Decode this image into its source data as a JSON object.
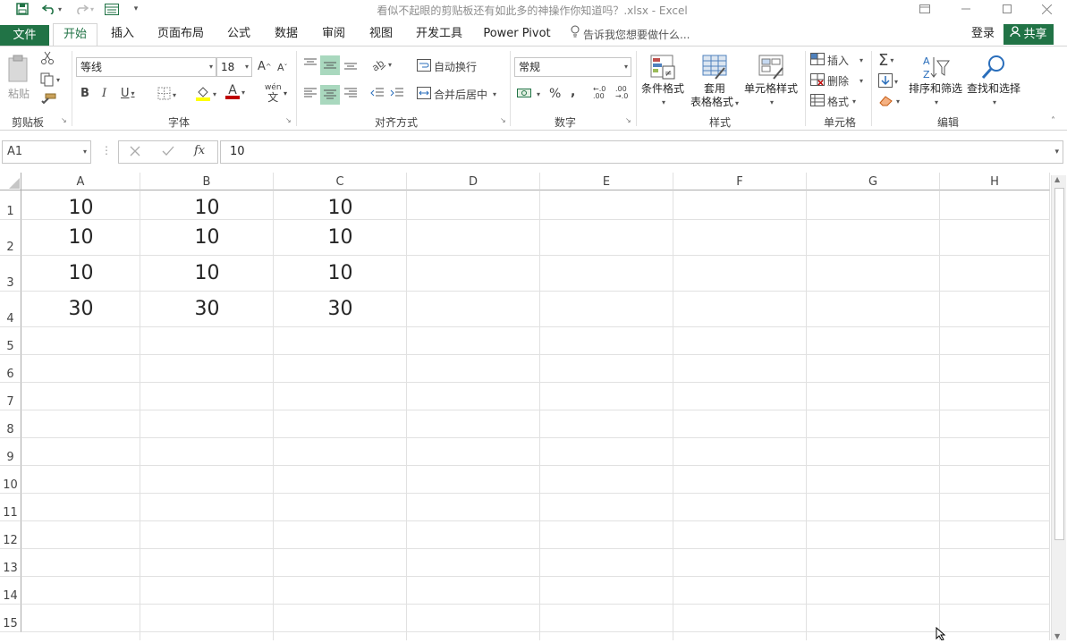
{
  "window": {
    "title": "看似不起眼的剪贴板还有如此多的神操作你知道吗？.xlsx - Excel"
  },
  "tabs": {
    "file": "文件",
    "items": [
      "开始",
      "插入",
      "页面布局",
      "公式",
      "数据",
      "审阅",
      "视图",
      "开发工具",
      "Power Pivot"
    ],
    "tell_me": "告诉我您想要做什么...",
    "login": "登录",
    "share": "共享"
  },
  "ribbon": {
    "clipboard": {
      "paste": "粘贴",
      "group": "剪贴板"
    },
    "font": {
      "name": "等线",
      "size": "18",
      "group": "字体",
      "bold": "B",
      "italic": "I",
      "underline": "U",
      "font_color_glyph": "A",
      "grow": "A",
      "shrink": "A",
      "phonetic": "wén"
    },
    "alignment": {
      "wrap": "自动换行",
      "merge": "合并后居中",
      "group": "对齐方式"
    },
    "number": {
      "format": "常规",
      "percent": "%",
      "comma": ",",
      "group": "数字",
      "inc_decimal": "←.0\n.00",
      "dec_decimal": ".00\n→.0"
    },
    "styles": {
      "conditional": "条件格式",
      "table_1": "套用",
      "table_2": "表格格式",
      "cell_styles": "单元格样式",
      "group": "样式"
    },
    "cells": {
      "insert": "插入",
      "delete": "删除",
      "format": "格式",
      "group": "单元格"
    },
    "editing": {
      "sort": "排序和筛选",
      "find": "查找和选择",
      "group": "编辑",
      "sum_glyph": "Σ"
    }
  },
  "formula_bar": {
    "name_box": "A1",
    "value": "10",
    "fx": "fx"
  },
  "sheet": {
    "columns": [
      "A",
      "B",
      "C",
      "D",
      "E",
      "F",
      "G",
      "H"
    ],
    "rows": [
      "1",
      "2",
      "3",
      "4",
      "5",
      "6",
      "7",
      "8",
      "9",
      "10",
      "11",
      "12",
      "13",
      "14",
      "15"
    ],
    "cells": [
      [
        "10",
        "10",
        "10"
      ],
      [
        "10",
        "10",
        "10"
      ],
      [
        "10",
        "10",
        "10"
      ],
      [
        "30",
        "30",
        "30"
      ]
    ]
  }
}
